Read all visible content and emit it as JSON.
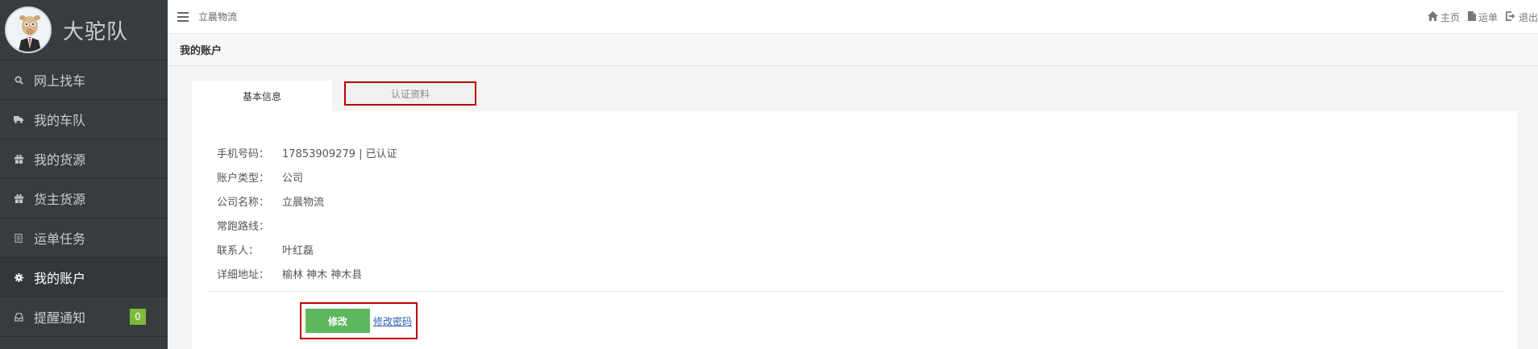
{
  "brand": {
    "name": "大驼队"
  },
  "sidebar": {
    "items": [
      {
        "label": "网上找车",
        "icon": "search-icon",
        "active": false
      },
      {
        "label": "我的车队",
        "icon": "truck-icon",
        "active": false
      },
      {
        "label": "我的货源",
        "icon": "gift-icon",
        "active": false
      },
      {
        "label": "货主货源",
        "icon": "gift-icon",
        "active": false
      },
      {
        "label": "运单任务",
        "icon": "list-icon",
        "active": false
      },
      {
        "label": "我的账户",
        "icon": "gear-icon",
        "active": true
      },
      {
        "label": "提醒通知",
        "icon": "inbox-icon",
        "active": false,
        "badge": "0"
      }
    ]
  },
  "topbar": {
    "title": "立晨物流",
    "links": {
      "home": "主页",
      "waybill": "运单",
      "logout": "退出"
    }
  },
  "page": {
    "title": "我的账户"
  },
  "tabs": {
    "basic": "基本信息",
    "certification": "认证资料"
  },
  "account": {
    "phone_label": "手机号码：",
    "phone_value": "17853909279 | 已认证",
    "type_label": "账户类型：",
    "type_value": "公司",
    "company_label": "公司名称：",
    "company_value": "立晨物流",
    "route_label": "常跑路线：",
    "route_value": "",
    "contact_label": "联系人：",
    "contact_value": "叶红磊",
    "address_label": "详细地址：",
    "address_value": "榆林 神木 神木县"
  },
  "actions": {
    "edit_label": "修改",
    "change_password_label": "修改密码"
  },
  "colors": {
    "sidebar_bg": "#393c3f",
    "highlight_border": "#c00000",
    "edit_button": "#5cb85c",
    "badge": "#7cbb3a"
  }
}
